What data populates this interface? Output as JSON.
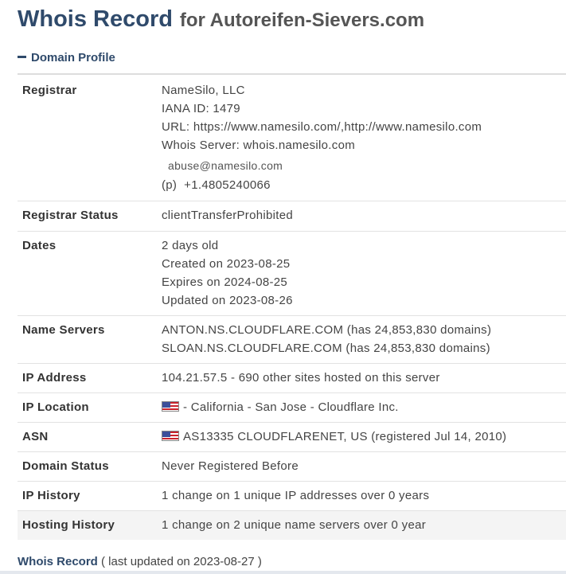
{
  "title": {
    "main": "Whois Record",
    "sub": "for Autoreifen-Sievers.com"
  },
  "profile_section": {
    "label": "Domain Profile"
  },
  "rows": {
    "registrar": {
      "label": "Registrar",
      "lines": [
        "NameSilo, LLC",
        "IANA ID: 1479",
        "URL: https://www.namesilo.com/,http://www.namesilo.com",
        "Whois Server: whois.namesilo.com"
      ],
      "email": "abuse@namesilo.com",
      "phone_prefix": "(p)",
      "phone": "+1.4805240066"
    },
    "registrar_status": {
      "label": "Registrar Status",
      "value": "clientTransferProhibited"
    },
    "dates": {
      "label": "Dates",
      "lines": [
        "2 days old",
        "Created on 2023-08-25",
        "Expires on 2024-08-25",
        "Updated on 2023-08-26"
      ]
    },
    "name_servers": {
      "label": "Name Servers",
      "lines": [
        "ANTON.NS.CLOUDFLARE.COM (has 24,853,830 domains)",
        "SLOAN.NS.CLOUDFLARE.COM (has 24,853,830 domains)"
      ]
    },
    "ip_address": {
      "label": "IP Address",
      "value": "104.21.57.5 - 690 other sites hosted on this server"
    },
    "ip_location": {
      "label": "IP Location",
      "value": "- California - San Jose - Cloudflare Inc.",
      "flag_icon": "us-flag-icon"
    },
    "asn": {
      "label": "ASN",
      "value": "AS13335 CLOUDFLARENET, US (registered Jul 14, 2010)",
      "flag_icon": "us-flag-icon"
    },
    "domain_status": {
      "label": "Domain Status",
      "value": "Never Registered Before"
    },
    "ip_history": {
      "label": "IP History",
      "value": "1 change on 1 unique IP addresses over 0 years"
    },
    "hosting_history": {
      "label": "Hosting History",
      "value": "1 change on 2 unique name servers over 0 year"
    }
  },
  "footer": {
    "link": "Whois Record",
    "note": "( last updated on 2023-08-27 )"
  },
  "colors": {
    "heading": "#2f4a6b",
    "shaded_row": "#f4f4f4",
    "divider": "#e2e2e2"
  }
}
